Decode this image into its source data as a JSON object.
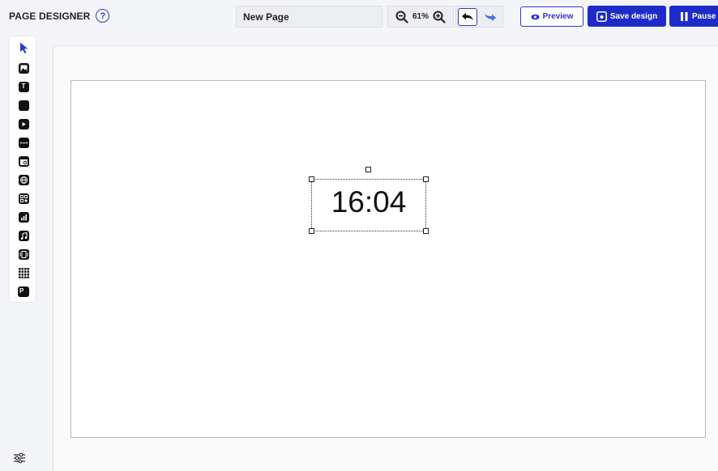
{
  "header": {
    "title": "PAGE DESIGNER",
    "help_glyph": "?",
    "page_name": "New Page",
    "zoom": "61%",
    "preview_label": "Preview",
    "save_label": "Save design",
    "pause_label": "Pause"
  },
  "toolbox": {
    "items": [
      {
        "name": "select-tool",
        "icon": "arrow-cursor-icon"
      },
      {
        "name": "image-tool",
        "icon": "image-icon"
      },
      {
        "name": "text-tool",
        "icon": "text-icon",
        "glyph": "T"
      },
      {
        "name": "shape-tool",
        "icon": "shape-icon"
      },
      {
        "name": "video-tool",
        "icon": "video-icon"
      },
      {
        "name": "ticker-tool",
        "icon": "ticker-icon"
      },
      {
        "name": "date-tool",
        "icon": "calendar-icon"
      },
      {
        "name": "web-tool",
        "icon": "globe-icon"
      },
      {
        "name": "qr-tool",
        "icon": "qr-icon"
      },
      {
        "name": "chart-tool",
        "icon": "chart-icon"
      },
      {
        "name": "audio-tool",
        "icon": "music-icon"
      },
      {
        "name": "carousel-tool",
        "icon": "carousel-icon"
      },
      {
        "name": "grid-tool",
        "icon": "grid-icon"
      },
      {
        "name": "powerpoint-tool",
        "icon": "powerpoint-icon",
        "glyph": "P"
      }
    ]
  },
  "canvas": {
    "clock_text": "16:04"
  },
  "colors": {
    "accent": "#1f2bc9",
    "background": "#f4f5f9"
  }
}
